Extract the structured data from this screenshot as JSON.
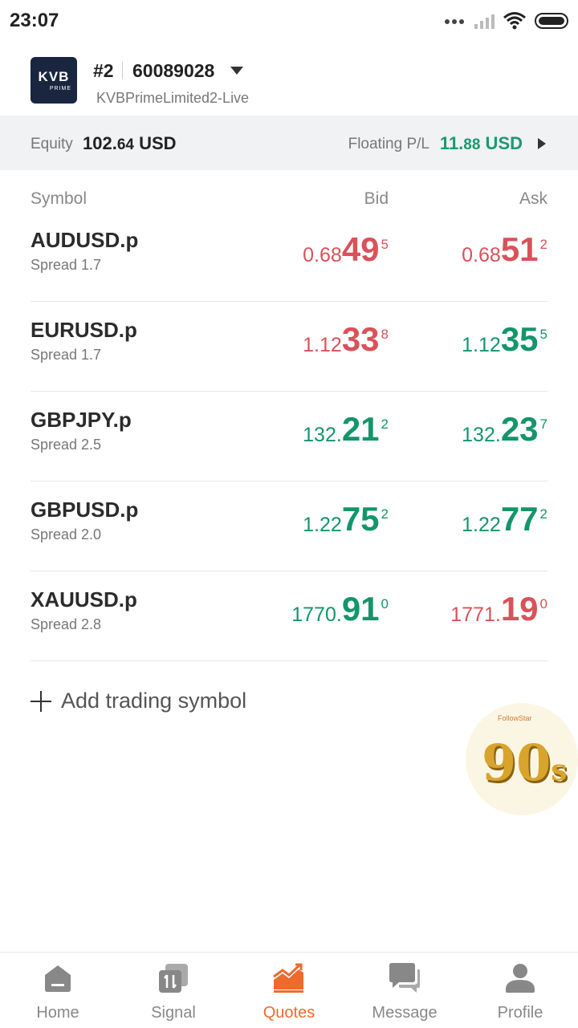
{
  "status": {
    "time": "23:07"
  },
  "account": {
    "logo_text": "KVB",
    "logo_sub": "PRIME",
    "number": "#2",
    "id": "60089028",
    "server": "KVBPrimeLimited2-Live"
  },
  "summary": {
    "equity_label": "Equity",
    "equity_main": "102.",
    "equity_small": "64",
    "equity_unit": " USD",
    "pl_label": "Floating P/L",
    "pl_main": "11.",
    "pl_small": "88",
    "pl_unit": " USD"
  },
  "headers": {
    "symbol": "Symbol",
    "bid": "Bid",
    "ask": "Ask"
  },
  "quotes": [
    {
      "symbol": "AUDUSD.p",
      "spread": "Spread 1.7",
      "bid": [
        "0.68",
        "49",
        "5"
      ],
      "ask": [
        "0.68",
        "51",
        "2"
      ],
      "bid_dir": "down",
      "ask_dir": "down"
    },
    {
      "symbol": "EURUSD.p",
      "spread": "Spread 1.7",
      "bid": [
        "1.12",
        "33",
        "8"
      ],
      "ask": [
        "1.12",
        "35",
        "5"
      ],
      "bid_dir": "down",
      "ask_dir": "up"
    },
    {
      "symbol": "GBPJPY.p",
      "spread": "Spread 2.5",
      "bid": [
        "132.",
        "21",
        "2"
      ],
      "ask": [
        "132.",
        "23",
        "7"
      ],
      "bid_dir": "up",
      "ask_dir": "up"
    },
    {
      "symbol": "GBPUSD.p",
      "spread": "Spread 2.0",
      "bid": [
        "1.22",
        "75",
        "2"
      ],
      "ask": [
        "1.22",
        "77",
        "2"
      ],
      "bid_dir": "up",
      "ask_dir": "up"
    },
    {
      "symbol": "XAUUSD.p",
      "spread": "Spread 2.8",
      "bid": [
        "1770.",
        "91",
        "0"
      ],
      "ask": [
        "1771.",
        "19",
        "0"
      ],
      "bid_dir": "up",
      "ask_dir": "down"
    }
  ],
  "add_symbol": "Add trading symbol",
  "promo": {
    "brand": "FollowStar",
    "number": "90",
    "suffix": "s"
  },
  "tabs": [
    {
      "label": "Home",
      "icon": "home-icon"
    },
    {
      "label": "Signal",
      "icon": "signal-icon"
    },
    {
      "label": "Quotes",
      "icon": "chart-icon",
      "active": true
    },
    {
      "label": "Message",
      "icon": "message-icon"
    },
    {
      "label": "Profile",
      "icon": "profile-icon"
    }
  ],
  "colors": {
    "up": "#14956a",
    "down": "#d9525a",
    "accent": "#ef6a2d"
  }
}
